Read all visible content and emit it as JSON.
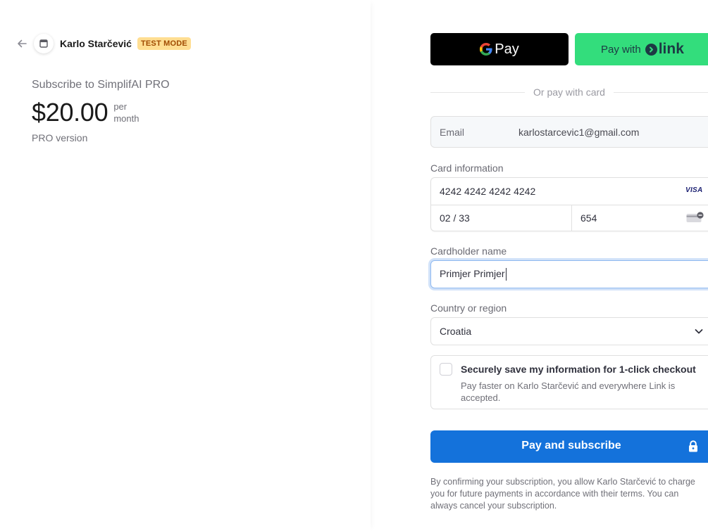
{
  "colors": {
    "test_badge_bg": "#ffde92",
    "link_green": "#33dd7c",
    "pay_button_blue": "#1472db",
    "focus_ring": "#8fb9f0"
  },
  "icons": {
    "back": "back-arrow-icon",
    "merchant": "merchant-placeholder-icon",
    "google": "google-g-icon",
    "link": "link-logo-icon",
    "card_brand": "visa-icon",
    "cvc": "cvc-card-icon",
    "select": "chevron-down-icon",
    "lock": "lock-icon"
  },
  "header": {
    "merchant_name": "Karlo Starčević",
    "test_badge": "TEST MODE"
  },
  "summary": {
    "title": "Subscribe to SimplifAI PRO",
    "price": "$20.00",
    "period_line1": "per",
    "period_line2": "month",
    "description": "PRO version"
  },
  "wallets": {
    "gpay_label": "Pay",
    "link_prefix": "Pay with",
    "link_word": "link"
  },
  "divider_text": "Or pay with card",
  "email": {
    "label": "Email",
    "value": "karlostarcevic1@gmail.com"
  },
  "card": {
    "section_label": "Card information",
    "number": "4242 4242 4242 4242",
    "brand": "VISA",
    "expiry": "02 / 33",
    "cvc": "654"
  },
  "cardholder": {
    "label": "Cardholder name",
    "value": "Primjer Primjer"
  },
  "country": {
    "label": "Country or region",
    "selected": "Croatia"
  },
  "save_info": {
    "title": "Securely save my information for 1-click checkout",
    "description": "Pay faster on Karlo Starčević and everywhere Link is accepted."
  },
  "pay_button": {
    "label": "Pay and subscribe"
  },
  "legal_text": "By confirming your subscription, you allow Karlo Starčević to charge you for future payments in accordance with their terms. You can always cancel your subscription."
}
